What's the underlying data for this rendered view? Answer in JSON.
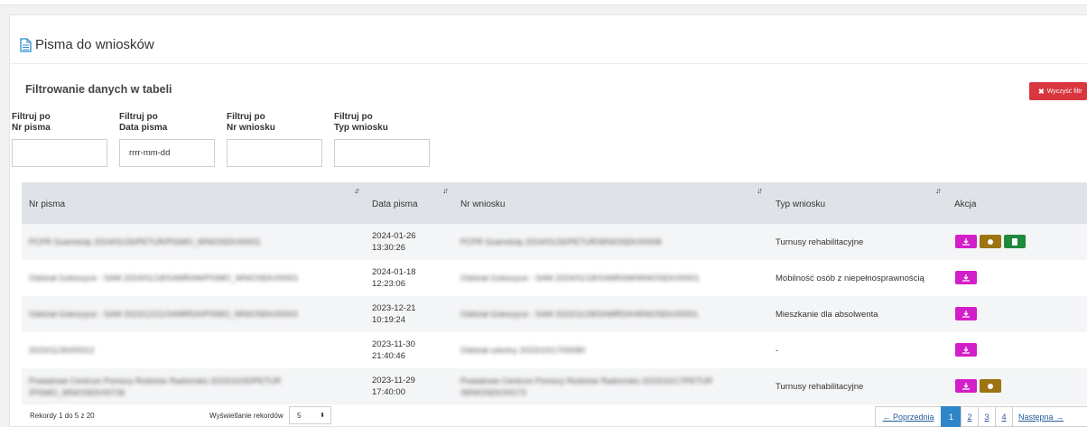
{
  "panel": {
    "title": "Pisma do wniosków"
  },
  "filters": {
    "title": "Filtrowanie danych w tabeli",
    "clear_label": "Wyczyść filtr",
    "fields": [
      {
        "label_line1": "Filtruj po",
        "label_line2": "Nr pisma",
        "placeholder": ""
      },
      {
        "label_line1": "Filtruj po",
        "label_line2": "Data pisma",
        "placeholder": "rrrr-mm-dd"
      },
      {
        "label_line1": "Filtruj po",
        "label_line2": "Nr wniosku",
        "placeholder": ""
      },
      {
        "label_line1": "Filtruj po",
        "label_line2": "Typ wniosku",
        "placeholder": ""
      }
    ]
  },
  "table": {
    "columns": [
      "Nr pisma",
      "Data pisma",
      "Nr wniosku",
      "Typ wniosku",
      "Akcja"
    ],
    "rows": [
      {
        "nr_pisma": "PCPR Szamotuły 2024/01/26/PETUR/PISMO_WNIOSEK/00001",
        "date": "2024-01-26",
        "time": "13:30:26",
        "nr_wniosku": "PCPR Szamotuły 2024/01/26/PETUR/WNIOSEK/00008",
        "typ": "Turnusy rehabilitacyjne",
        "actions": [
          "download",
          "circle",
          "document"
        ]
      },
      {
        "nr_pisma": "Oddział Gołoszyce - SAM 2024/01/18/SAMRAM/PISMO_WNIOSEK/00001",
        "date": "2024-01-18",
        "time": "12:23:06",
        "nr_wniosku": "Oddział Gołoszyce - SAM 2024/01/18/SAMRAM/WNIOSEK/00001",
        "typ": "Mobilność osób z niepełnosprawnością",
        "actions": [
          "download"
        ]
      },
      {
        "nr_pisma": "Oddział Gołoszyce - SAM 2023/12/21/SAMRDA/PISMO_WNIOSEK/00003",
        "date": "2023-12-21",
        "time": "10:19:24",
        "nr_wniosku": "Oddział Gołoszyce - SAM 2023/11/28/SAMRDA/WNIOSEK/00001",
        "typ": "Mieszkanie dla absolwenta",
        "actions": [
          "download"
        ]
      },
      {
        "nr_pisma": "2023/11/30/00013",
        "date": "2023-11-30",
        "time": "21:40:46",
        "nr_wniosku": "Oddział szkolny 2023/10/17/00080",
        "typ": "-",
        "actions": [
          "download"
        ]
      },
      {
        "nr_pisma_line1": "Powiatowe Centrum Pomocy Rodzinie Radomsko 2023/10/30/PETUR",
        "nr_pisma_line2": "/PISMO_WNIOSEK/00736",
        "date": "2023-11-29",
        "time": "17:40:00",
        "nr_wniosku_line1": "Powiatowe Centrum Pomocy Rodzinie Radomsko 2023/10/17/PETUR",
        "nr_wniosku_line2": "/WNIOSEK/00173",
        "typ": "Turnusy rehabilitacyjne",
        "actions": [
          "download",
          "circle"
        ]
      }
    ]
  },
  "footer": {
    "info": "Rekordy 1 do 5 z 20",
    "perpage_label": "Wyświetlanie rekordów",
    "perpage_value": "5",
    "pagination": {
      "prev": "← Poprzednia",
      "pages": [
        "1",
        "2",
        "3",
        "4"
      ],
      "active": "1",
      "next": "Następna →"
    }
  },
  "colors": {
    "download_btn": "#d31fc9",
    "circle_btn": "#9c7412",
    "document_btn": "#1e8a3c",
    "clear_btn": "#d9363e",
    "active_page": "#2e86c9"
  }
}
